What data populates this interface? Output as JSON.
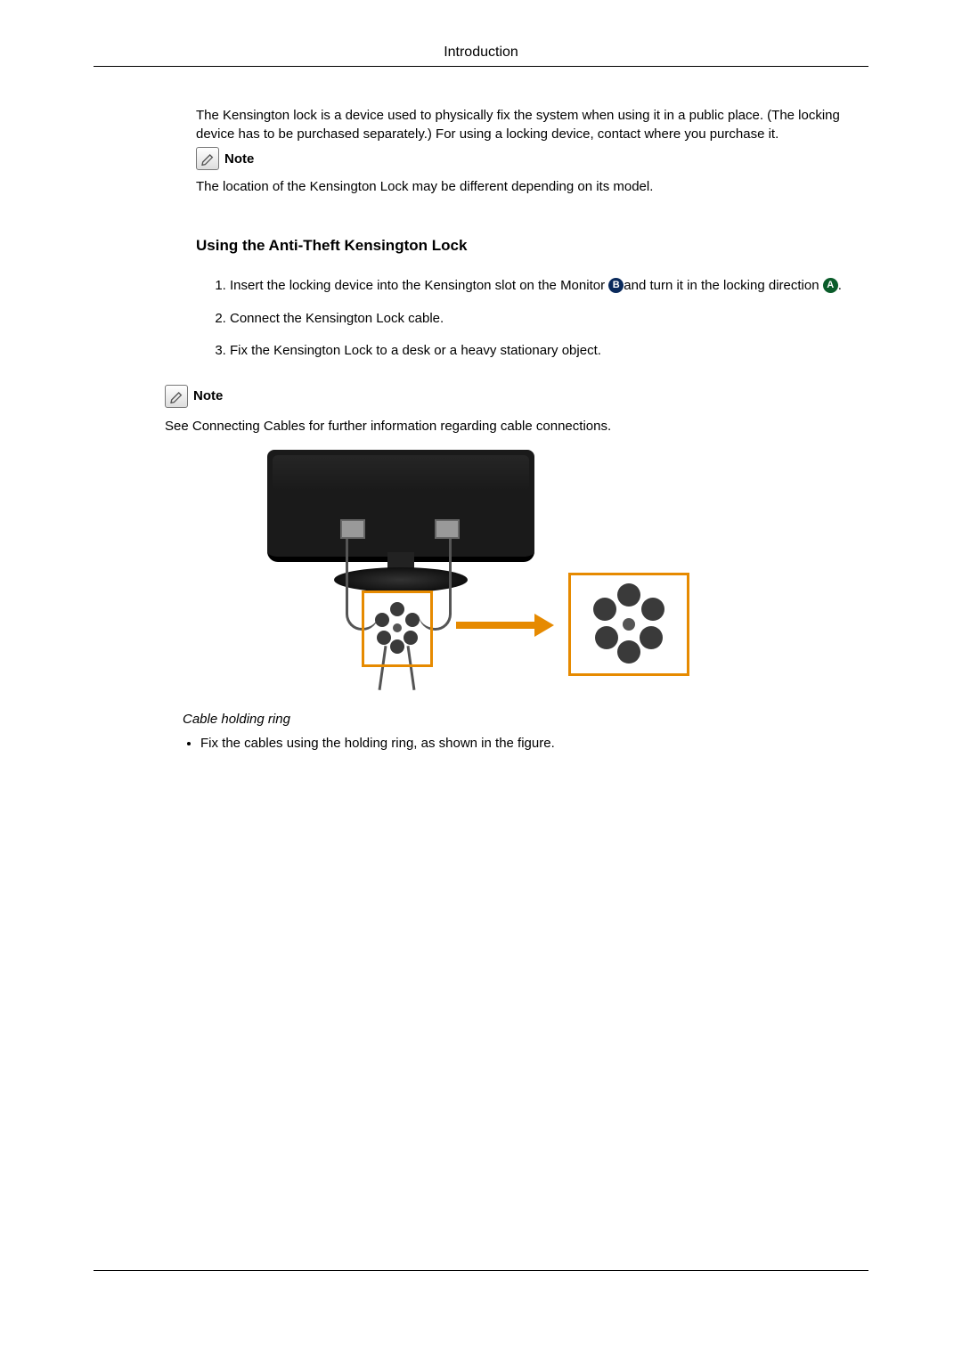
{
  "header": {
    "title": "Introduction"
  },
  "intro_paragraph": "The Kensington lock is a device used to physically fix the system when using it in a public place. (The locking device has to be purchased separately.) For using a locking device, contact where you purchase it.",
  "note_label": "Note",
  "note1_text": "The location of the Kensington Lock may be different depending on its model.",
  "subheading": "Using the Anti-Theft Kensington Lock",
  "steps": {
    "s1_a": "Insert the locking device into the Kensington slot on the Monitor ",
    "s1_b": "and turn it in the locking direction ",
    "s1_c": ".",
    "s2": "Connect the Kensington Lock cable.",
    "s3": "Fix the Kensington Lock to a desk or a heavy stationary object."
  },
  "badge_b": "B",
  "badge_a": "A",
  "note2_text": "See Connecting Cables for further information regarding cable connections.",
  "caption": "Cable holding ring",
  "bullet1": "Fix the cables using the holding ring, as shown in the figure."
}
